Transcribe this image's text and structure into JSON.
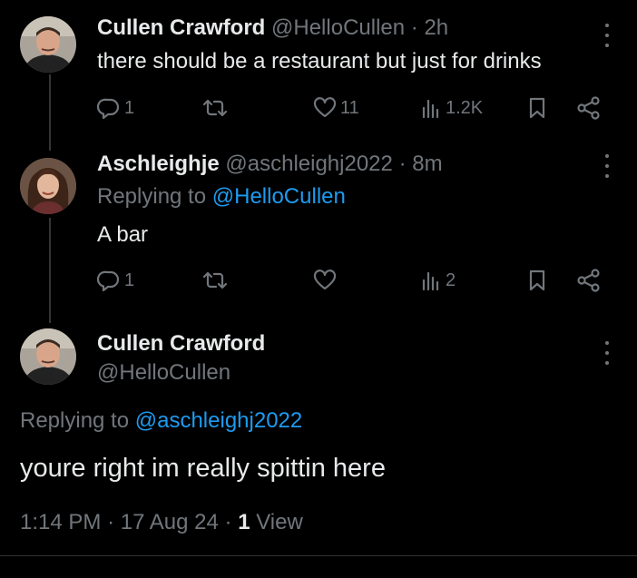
{
  "posts": [
    {
      "name": "Cullen Crawford",
      "handle": "@HelloCullen",
      "time": "2h",
      "text": "there should be a restaurant but just for drinks",
      "replies": "1",
      "reposts": "",
      "likes": "11",
      "views": "1.2K"
    },
    {
      "name": "Aschleighje",
      "handle": "@aschleighj2022",
      "time": "8m",
      "replying_prefix": "Replying to",
      "replying_handle": "@HelloCullen",
      "text": "A bar",
      "replies": "1",
      "reposts": "",
      "likes": "",
      "views": "2"
    }
  ],
  "focused": {
    "name": "Cullen Crawford",
    "handle": "@HelloCullen",
    "replying_prefix": "Replying to",
    "replying_handle": "@aschleighj2022",
    "text": "youre right im really spittin here",
    "time": "1:14 PM",
    "date": "17 Aug 24",
    "view_count": "1",
    "view_label": "View"
  },
  "icons": {
    "reply": "reply-icon",
    "repost": "repost-icon",
    "like": "heart-icon",
    "views": "views-icon",
    "bookmark": "bookmark-icon",
    "share": "share-icon",
    "more": "more-vertical-icon"
  },
  "colors": {
    "background": "#000000",
    "text": "#e7e9ea",
    "muted": "#71767b",
    "link": "#1d9bf0"
  }
}
